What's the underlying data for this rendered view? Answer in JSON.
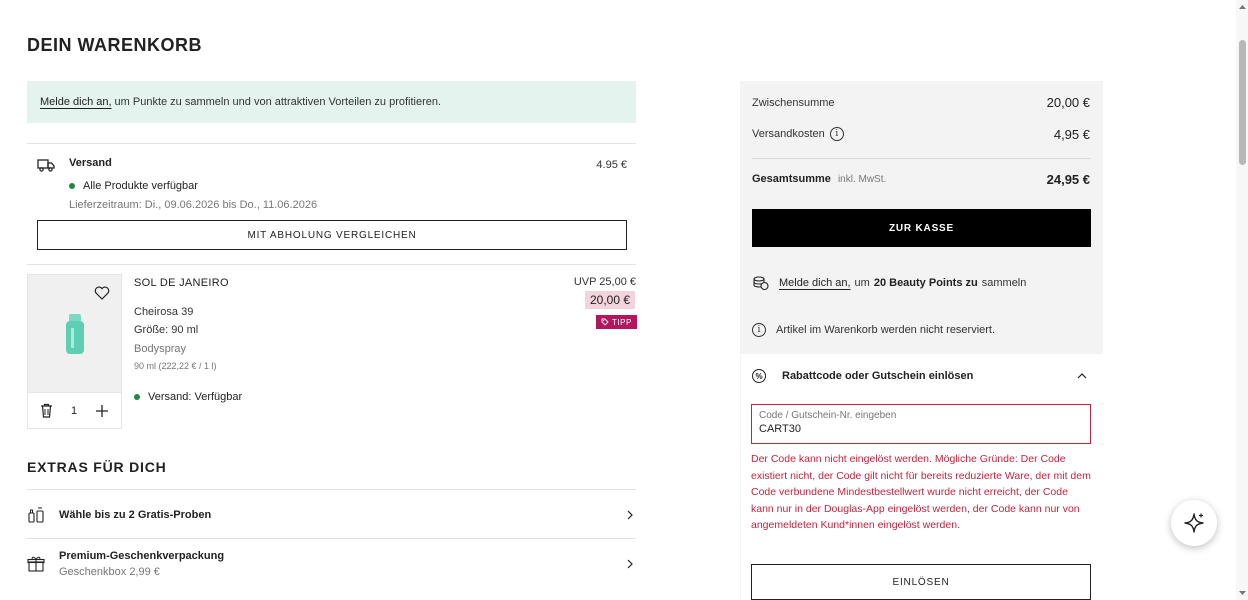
{
  "page": {
    "title": "DEIN WARENKORB"
  },
  "login_banner": {
    "link": "Melde dich an,",
    "text": "um Punkte zu sammeln und von attraktiven Vorteilen zu profitieren."
  },
  "shipping": {
    "title": "Versand",
    "price": "4.95 €",
    "availability": "Alle Produkte verfügbar",
    "period": "Lieferzeitraum: Di., 09.06.2026 bis Do., 11.06.2026",
    "compare_label": "MIT ABHOLUNG VERGLEICHEN"
  },
  "product": {
    "brand": "SOL DE JANEIRO",
    "name": "Cheirosa 39",
    "size": "Größe: 90 ml",
    "type": "Bodyspray",
    "base_price": "90 ml (222,22 € / 1 l)",
    "shipping": "Versand: Verfügbar",
    "uvp": "UVP 25,00 €",
    "price": "20,00 €",
    "badge": "TIPP",
    "quantity": "1"
  },
  "extras": {
    "title": "EXTRAS FÜR DICH",
    "items": [
      {
        "title": "Wähle bis zu 2 Gratis-Proben",
        "sub": ""
      },
      {
        "title": "Premium-Geschenkverpackung",
        "sub": "Geschenkbox 2,99 €"
      }
    ]
  },
  "summary": {
    "subtotal_label": "Zwischensumme",
    "subtotal_value": "20,00 €",
    "shipping_label": "Versandkosten",
    "shipping_value": "4,95 €",
    "total_label": "Gesamtsumme",
    "total_vat": "inkl. MwSt.",
    "total_value": "24,95 €",
    "checkout_label": "ZUR KASSE",
    "points_link": "Melde dich an,",
    "points_pre": "um",
    "points_bold": "20 Beauty Points zu",
    "points_post": "sammeln",
    "reserve_note": "Artikel im Warenkorb werden nicht reserviert."
  },
  "voucher": {
    "title": "Rabattcode oder Gutschein einlösen",
    "field_label": "Code / Gutschein-Nr. eingeben",
    "field_value": "CART30",
    "error": "Der Code kann nicht eingelöst werden. Mögliche Gründe: Der Code existiert nicht, der Code gilt nicht für bereits reduzierte Ware, der mit dem Code verbundene Mindestbestellwert wurde nicht erreicht, der Code kann nur in der Douglas-App eingelöst werden, der Code kann nur von angemeldeten Kund*innen eingelöst werden.",
    "redeem_label": "EINLÖSEN"
  },
  "colors": {
    "banner_bg": "#e5f3ee",
    "accent_pink": "#b3165c",
    "price_highlight": "#f3d4dc",
    "error_red": "#c8233b",
    "available_green": "#1e8a3e"
  },
  "icons": {
    "shipping": "truck-icon",
    "wishlist": "heart-icon",
    "delete": "trash-icon",
    "increase": "plus-icon",
    "badge": "tag-icon",
    "samples": "samples-icon",
    "gift": "gift-icon",
    "points": "coins-icon",
    "info": "info-icon",
    "voucher": "percent-icon",
    "assistant": "sparkle-icon"
  }
}
